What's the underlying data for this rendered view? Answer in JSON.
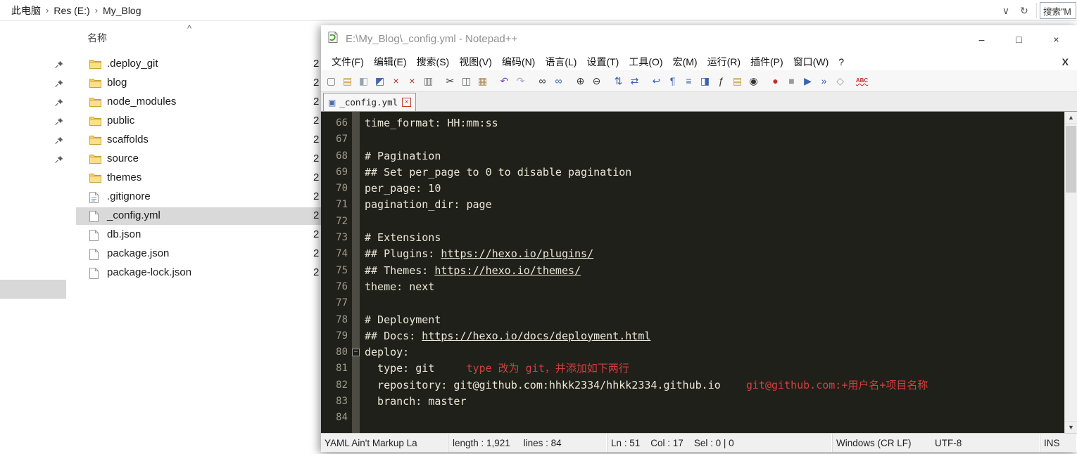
{
  "colors": {
    "editor_bg": "#20201a",
    "editor_fg": "#e8e8d8",
    "annotation_red": "#d23f3f",
    "selection_gray": "#d9d9d9"
  },
  "explorer": {
    "breadcrumb": {
      "items": [
        "此电脑",
        "Res (E:)",
        "My_Blog"
      ]
    },
    "controls": {
      "chevron": "∨",
      "refresh": "↻",
      "search_text": "搜索\"M"
    },
    "list": {
      "name_header": "名称",
      "sort_indicator": "^",
      "items": [
        {
          "label": ".deploy_git",
          "type": "folder",
          "pinned": true,
          "date_hint": "2"
        },
        {
          "label": "blog",
          "type": "folder",
          "pinned": true,
          "date_hint": "2"
        },
        {
          "label": "node_modules",
          "type": "folder",
          "pinned": true,
          "date_hint": "2"
        },
        {
          "label": "public",
          "type": "folder",
          "pinned": true,
          "date_hint": "2"
        },
        {
          "label": "scaffolds",
          "type": "folder",
          "pinned": true,
          "date_hint": "2"
        },
        {
          "label": "source",
          "type": "folder",
          "pinned": true,
          "date_hint": "2"
        },
        {
          "label": "themes",
          "type": "folder",
          "pinned": false,
          "date_hint": "2"
        },
        {
          "label": ".gitignore",
          "type": "file-lines",
          "pinned": false,
          "date_hint": "2"
        },
        {
          "label": "_config.yml",
          "type": "file",
          "pinned": false,
          "selected": true,
          "date_hint": "2"
        },
        {
          "label": "db.json",
          "type": "file",
          "pinned": false,
          "date_hint": "2"
        },
        {
          "label": "package.json",
          "type": "file",
          "pinned": false,
          "date_hint": "2"
        },
        {
          "label": "package-lock.json",
          "type": "file",
          "pinned": false,
          "date_hint": "2"
        }
      ]
    }
  },
  "notepad": {
    "title": "E:\\My_Blog\\_config.yml - Notepad++",
    "window_buttons": {
      "minimize": "–",
      "maximize": "□",
      "close": "×"
    },
    "menu": {
      "items": [
        "文件(F)",
        "编辑(E)",
        "搜索(S)",
        "视图(V)",
        "编码(N)",
        "语言(L)",
        "设置(T)",
        "工具(O)",
        "宏(M)",
        "运行(R)",
        "插件(P)",
        "窗口(W)",
        "?"
      ],
      "right": "X"
    },
    "toolbar": [
      {
        "name": "new-file",
        "glyph": "▢",
        "color": "#777"
      },
      {
        "name": "open-folder",
        "glyph": "▤",
        "color": "#c89b3c"
      },
      {
        "name": "save",
        "glyph": "◧",
        "color": "#9aa4b0"
      },
      {
        "name": "save-all",
        "glyph": "◩",
        "color": "#49659e"
      },
      {
        "name": "close-file",
        "glyph": "×",
        "color": "#b03030"
      },
      {
        "name": "close-all",
        "glyph": "×",
        "color": "#b03030"
      },
      {
        "name": "print",
        "glyph": "▥",
        "color": "#777"
      },
      {
        "name": "cut",
        "glyph": "✂",
        "color": "#333",
        "gap": true
      },
      {
        "name": "copy",
        "glyph": "◫",
        "color": "#666"
      },
      {
        "name": "paste",
        "glyph": "▦",
        "color": "#b08d57"
      },
      {
        "name": "undo",
        "glyph": "↶",
        "color": "#7b3fb0",
        "gap": true
      },
      {
        "name": "redo",
        "glyph": "↷",
        "color": "#b0a0c8"
      },
      {
        "name": "find",
        "glyph": "∞",
        "color": "#333",
        "gap": true
      },
      {
        "name": "replace",
        "glyph": "∞",
        "color": "#3a62b0"
      },
      {
        "name": "zoom-in",
        "glyph": "⊕",
        "color": "#333",
        "gap": true
      },
      {
        "name": "zoom-out",
        "glyph": "⊖",
        "color": "#333"
      },
      {
        "name": "sync-vertical",
        "glyph": "⇅",
        "color": "#3a62b0",
        "gap": true
      },
      {
        "name": "sync-horizontal",
        "glyph": "⇄",
        "color": "#3a62b0"
      },
      {
        "name": "word-wrap",
        "glyph": "↩",
        "color": "#3a62b0",
        "gap": true
      },
      {
        "name": "show-all-characters",
        "glyph": "¶",
        "color": "#3a62b0"
      },
      {
        "name": "indent-guide",
        "glyph": "≡",
        "color": "#3a62b0"
      },
      {
        "name": "document-map",
        "glyph": "◨",
        "color": "#3a62b0"
      },
      {
        "name": "function-list",
        "glyph": "ƒ",
        "color": "#333"
      },
      {
        "name": "folder-as-workspace",
        "glyph": "▤",
        "color": "#c89b3c"
      },
      {
        "name": "monitoring",
        "glyph": "◉",
        "color": "#333"
      },
      {
        "name": "macro-record",
        "glyph": "●",
        "color": "#c03030",
        "gap": true
      },
      {
        "name": "macro-stop",
        "glyph": "■",
        "color": "#999"
      },
      {
        "name": "macro-play",
        "glyph": "▶",
        "color": "#3a62b0"
      },
      {
        "name": "macro-run-multiple",
        "glyph": "»",
        "color": "#3a62b0"
      },
      {
        "name": "macro-save",
        "glyph": "◇",
        "color": "#999"
      },
      {
        "name": "spell-check",
        "glyph": "ABC",
        "color": "#c03030",
        "abc": true,
        "gap": true
      }
    ],
    "tab": {
      "icon": "▣",
      "label": "_config.yml",
      "close": "×"
    },
    "editor": {
      "lines": [
        {
          "no": 66,
          "seg": [
            {
              "t": "text",
              "v": "time_format: HH:mm:ss"
            }
          ]
        },
        {
          "no": 67,
          "seg": []
        },
        {
          "no": 68,
          "seg": [
            {
              "t": "text",
              "v": "# Pagination"
            }
          ]
        },
        {
          "no": 69,
          "seg": [
            {
              "t": "text",
              "v": "## Set per_page to 0 to disable pagination"
            }
          ]
        },
        {
          "no": 70,
          "seg": [
            {
              "t": "text",
              "v": "per_page: 10"
            }
          ]
        },
        {
          "no": 71,
          "seg": [
            {
              "t": "text",
              "v": "pagination_dir: page"
            }
          ]
        },
        {
          "no": 72,
          "seg": []
        },
        {
          "no": 73,
          "seg": [
            {
              "t": "text",
              "v": "# Extensions"
            }
          ]
        },
        {
          "no": 74,
          "seg": [
            {
              "t": "text",
              "v": "## Plugins: "
            },
            {
              "t": "link",
              "v": "https://hexo.io/plugins/"
            }
          ]
        },
        {
          "no": 75,
          "seg": [
            {
              "t": "text",
              "v": "## Themes: "
            },
            {
              "t": "link",
              "v": "https://hexo.io/themes/"
            }
          ]
        },
        {
          "no": 76,
          "seg": [
            {
              "t": "text",
              "v": "theme: next"
            }
          ]
        },
        {
          "no": 77,
          "seg": []
        },
        {
          "no": 78,
          "seg": [
            {
              "t": "text",
              "v": "# Deployment"
            }
          ]
        },
        {
          "no": 79,
          "seg": [
            {
              "t": "text",
              "v": "## Docs: "
            },
            {
              "t": "link",
              "v": "https://hexo.io/docs/deployment.html"
            }
          ]
        },
        {
          "no": 80,
          "fold": true,
          "seg": [
            {
              "t": "text",
              "v": "deploy:"
            }
          ]
        },
        {
          "no": 81,
          "seg": [
            {
              "t": "text",
              "v": "  type: git"
            },
            {
              "t": "ann",
              "v": "     type 改为 git，并添加如下两行"
            }
          ]
        },
        {
          "no": 82,
          "seg": [
            {
              "t": "text",
              "v": "  repository: git@github.com:hhkk2334/hhkk2334.github.io"
            },
            {
              "t": "ann",
              "v": "    git@github.com:+用户名+项目名称"
            }
          ]
        },
        {
          "no": 83,
          "seg": [
            {
              "t": "text",
              "v": "  branch: master"
            }
          ]
        },
        {
          "no": 84,
          "seg": []
        }
      ]
    },
    "status": {
      "segments": [
        {
          "name": "doc-type",
          "text": "YAML Ain't Markup La"
        },
        {
          "name": "doc-size",
          "text": "length : 1,921     lines : 84"
        },
        {
          "name": "cursor-position",
          "text": "Ln : 51    Col : 17    Sel : 0 | 0"
        },
        {
          "name": "eol-format",
          "text": "Windows (CR LF)"
        },
        {
          "name": "encoding",
          "text": "UTF-8"
        },
        {
          "name": "insert-mode",
          "text": "INS"
        }
      ]
    }
  }
}
